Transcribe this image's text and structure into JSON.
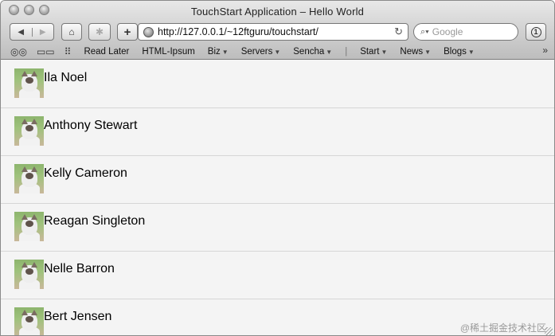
{
  "window": {
    "title": "TouchStart Application – Hello World"
  },
  "toolbar": {
    "back_icon": "back-arrow-icon",
    "forward_icon": "forward-arrow-icon",
    "url": "http://127.0.0.1/~12ftguru/touchstart/",
    "search_placeholder": "Google"
  },
  "bookmarks": [
    {
      "label": "Read Later",
      "menu": false
    },
    {
      "label": "HTML-Ipsum",
      "menu": false
    },
    {
      "label": "Biz",
      "menu": true
    },
    {
      "label": "Servers",
      "menu": true
    },
    {
      "label": "Sencha",
      "menu": true
    },
    {
      "label": "Start",
      "menu": true
    },
    {
      "label": "News",
      "menu": true
    },
    {
      "label": "Blogs",
      "menu": true
    }
  ],
  "list": {
    "items": [
      {
        "name": "Ila Noel"
      },
      {
        "name": "Anthony Stewart"
      },
      {
        "name": "Kelly Cameron"
      },
      {
        "name": "Reagan Singleton"
      },
      {
        "name": "Nelle Barron"
      },
      {
        "name": "Bert Jensen"
      }
    ]
  },
  "watermark": "@稀土掘金技术社区"
}
